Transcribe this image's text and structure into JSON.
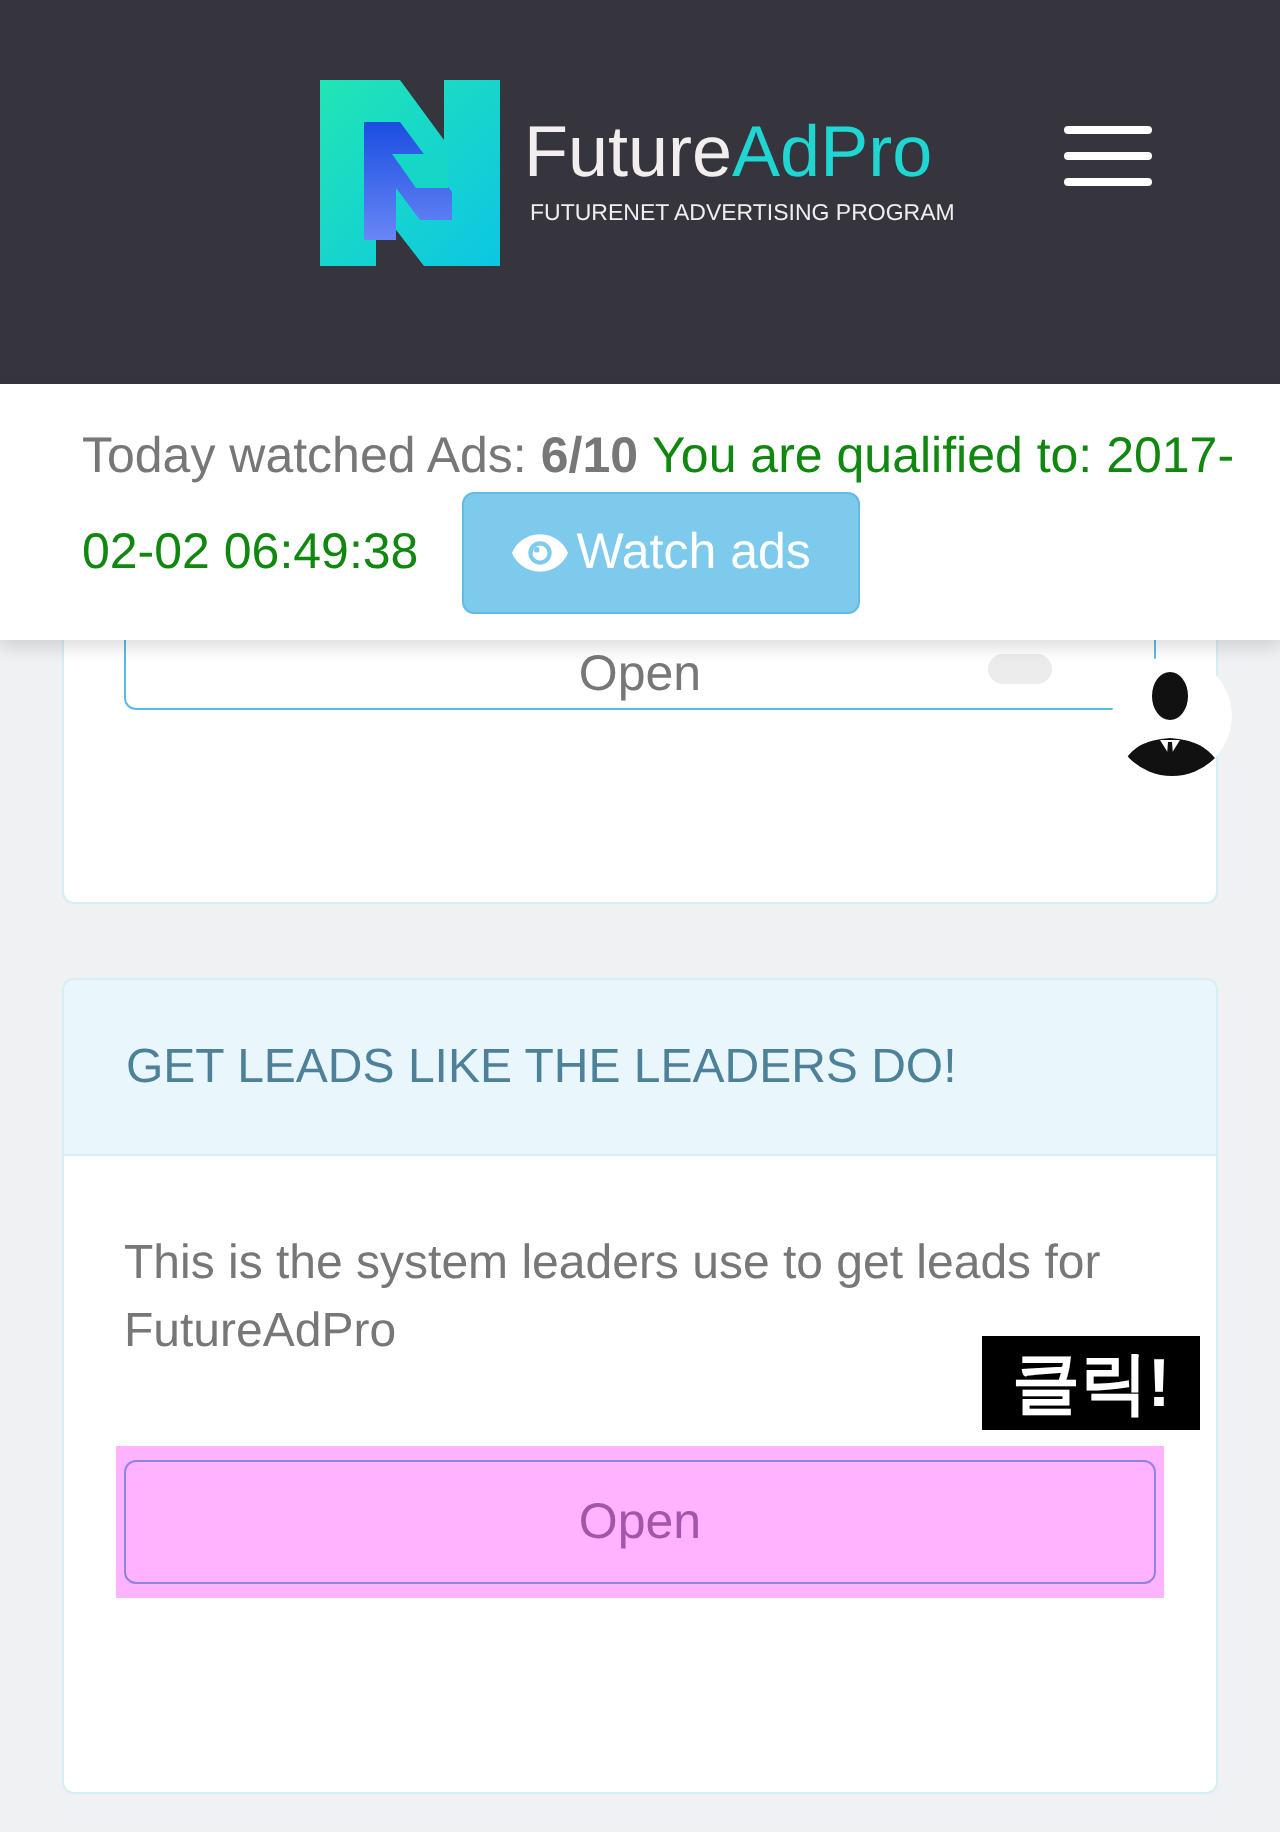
{
  "header": {
    "brand": {
      "first": "Future",
      "second": "AdPro"
    },
    "tagline": "FUTURENET ADVERTISING PROGRAM"
  },
  "ad_status": {
    "label": "Today watched Ads:",
    "count": "6/10",
    "qualified_lines": [
      "You are qualified to: 2017-",
      "02-02 06:49:38"
    ],
    "button": "Watch ads"
  },
  "cards": [
    {
      "kind": "partial",
      "button": "Open",
      "highlighted": false
    },
    {
      "kind": "panel",
      "title": "GET LEADS LIKE THE LEADERS DO!",
      "description": "This is the system leaders use to get leads for FutureAdPro",
      "button": "Open",
      "highlighted": true
    }
  ],
  "annotation": {
    "label": "클릭!"
  }
}
